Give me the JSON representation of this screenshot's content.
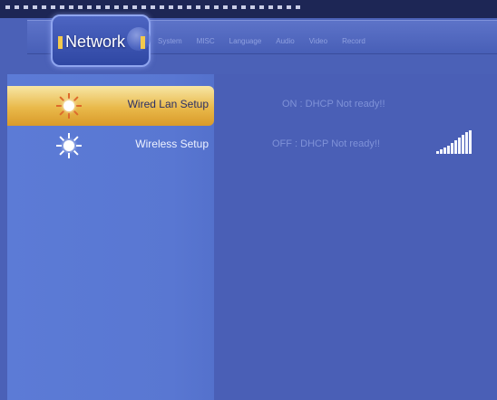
{
  "header": {
    "active_tab": "Network",
    "tabs": [
      "System",
      "MISC",
      "Language",
      "Audio",
      "Video",
      "Record"
    ]
  },
  "menu": {
    "items": [
      {
        "label": "Wired Lan Setup",
        "status": "ON : DHCP Not ready!!",
        "icon": "sun-icon",
        "selected": true
      },
      {
        "label": "Wireless Setup",
        "status": "OFF : DHCP Not ready!!",
        "icon": "sun-icon",
        "selected": false
      }
    ]
  },
  "wireless_signal": {
    "icon": "signal-strength-icon",
    "level_fraction": 1.0
  },
  "colors": {
    "background": "#4b61b7",
    "menu_panel": "#5c7bd6",
    "selected_row": "#e9b94a",
    "status_text": "#7f92d8"
  }
}
